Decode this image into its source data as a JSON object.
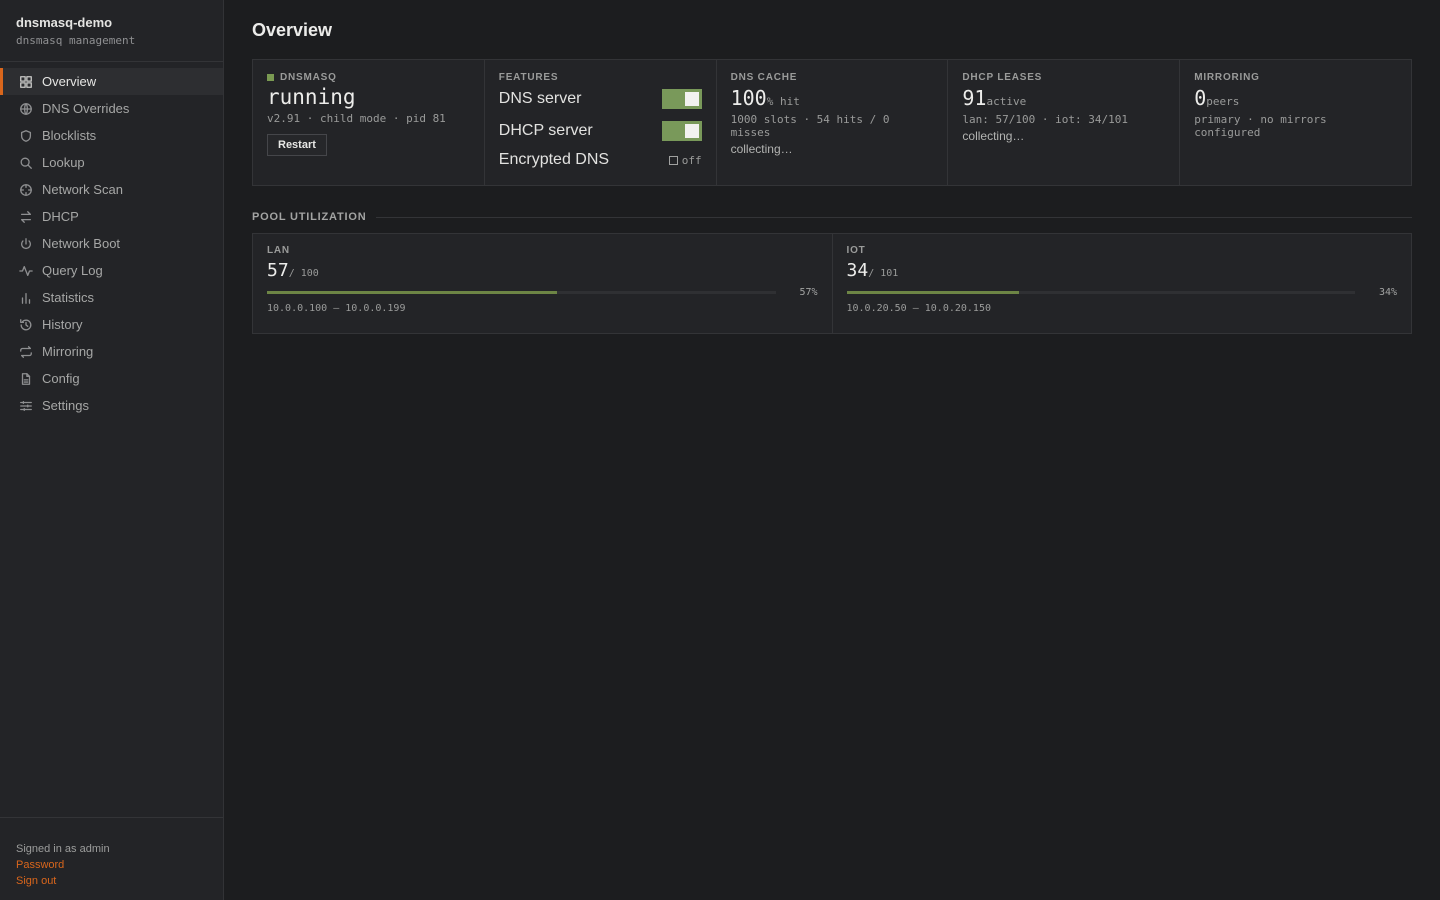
{
  "sidebar": {
    "brand": "dnsmasq-demo",
    "subtitle": "dnsmasq management",
    "items": [
      {
        "label": "Overview",
        "icon": "grid-icon",
        "active": true
      },
      {
        "label": "DNS Overrides",
        "icon": "globe-icon"
      },
      {
        "label": "Blocklists",
        "icon": "shield-icon"
      },
      {
        "label": "Lookup",
        "icon": "search-icon"
      },
      {
        "label": "Network Scan",
        "icon": "crosshair-icon"
      },
      {
        "label": "DHCP",
        "icon": "arrows-icon"
      },
      {
        "label": "Network Boot",
        "icon": "power-icon"
      },
      {
        "label": "Query Log",
        "icon": "activity-icon"
      },
      {
        "label": "Statistics",
        "icon": "bar-chart-icon"
      },
      {
        "label": "History",
        "icon": "history-icon"
      },
      {
        "label": "Mirroring",
        "icon": "repeat-icon"
      },
      {
        "label": "Config",
        "icon": "file-icon"
      },
      {
        "label": "Settings",
        "icon": "sliders-icon"
      }
    ],
    "footer": {
      "signed_in": "Signed in as admin",
      "password": "Password",
      "sign_out": "Sign out"
    }
  },
  "page": {
    "title": "Overview"
  },
  "cards": {
    "dnsmasq": {
      "label": "DNSMASQ",
      "status": "running",
      "meta": "v2.91 · child mode · pid 81",
      "restart": "Restart",
      "status_color": "#7a9a52"
    },
    "features": {
      "label": "FEATURES",
      "items": [
        {
          "label": "DNS server",
          "state": "on"
        },
        {
          "label": "DHCP server",
          "state": "on"
        },
        {
          "label": "Encrypted DNS",
          "state": "off",
          "state_label": "off"
        }
      ]
    },
    "dns_cache": {
      "label": "DNS CACHE",
      "value": "100",
      "unit": "% hit",
      "meta": "1000 slots · 54 hits / 0 misses",
      "note": "collecting…"
    },
    "dhcp_leases": {
      "label": "DHCP LEASES",
      "value": "91",
      "unit": "active",
      "meta": "lan: 57/100 · iot: 34/101",
      "note": "collecting…"
    },
    "mirroring": {
      "label": "MIRRORING",
      "value": "0",
      "unit": "peers",
      "meta": "primary · no mirrors configured"
    }
  },
  "pool_utilization": {
    "title": "POOL UTILIZATION",
    "pools": [
      {
        "label": "LAN",
        "used": "57",
        "total": "/ 100",
        "percent_label": "57%",
        "fraction": 0.57,
        "range": "10.0.0.100 – 10.0.0.199"
      },
      {
        "label": "IOT",
        "used": "34",
        "total": "/ 101",
        "percent_label": "34%",
        "fraction": 0.34,
        "range": "10.0.20.50 – 10.0.20.150"
      }
    ]
  },
  "colors": {
    "accent": "#d9661c",
    "ok": "#7a9a52"
  }
}
